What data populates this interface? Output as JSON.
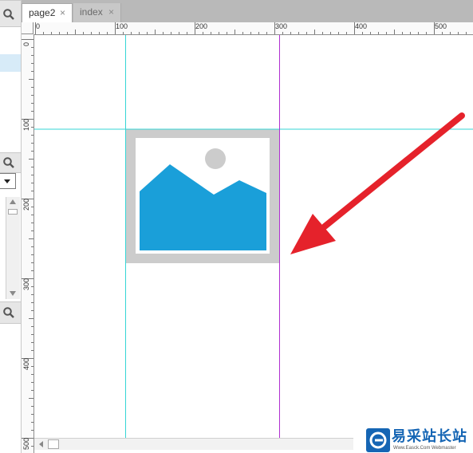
{
  "tabs": [
    {
      "label": "page2",
      "active": true
    },
    {
      "label": "index",
      "active": false
    }
  ],
  "tab_close_glyph": "×",
  "ruler": {
    "top_labels": [
      "0",
      "100",
      "200",
      "300",
      "400",
      "500"
    ],
    "left_labels": [
      "0",
      "100",
      "200",
      "300",
      "400",
      "500"
    ]
  },
  "canvas": {
    "image_placeholder": {
      "icon": "image-placeholder-icon",
      "fill_color": "#1a9fd9",
      "frame_color": "#cccccc"
    },
    "guides": {
      "cyan": "#35d6d6",
      "magenta": "#b02fd0"
    },
    "annotation_arrow_color": "#e5222b"
  },
  "watermark": {
    "title": "易采站长站",
    "subtitle": "Www.Easck.Com  Webmaster"
  },
  "colors": {
    "tab_bar": "#b9b9b9",
    "selection": "#d7ebf8",
    "brand_blue": "#1565b4"
  }
}
